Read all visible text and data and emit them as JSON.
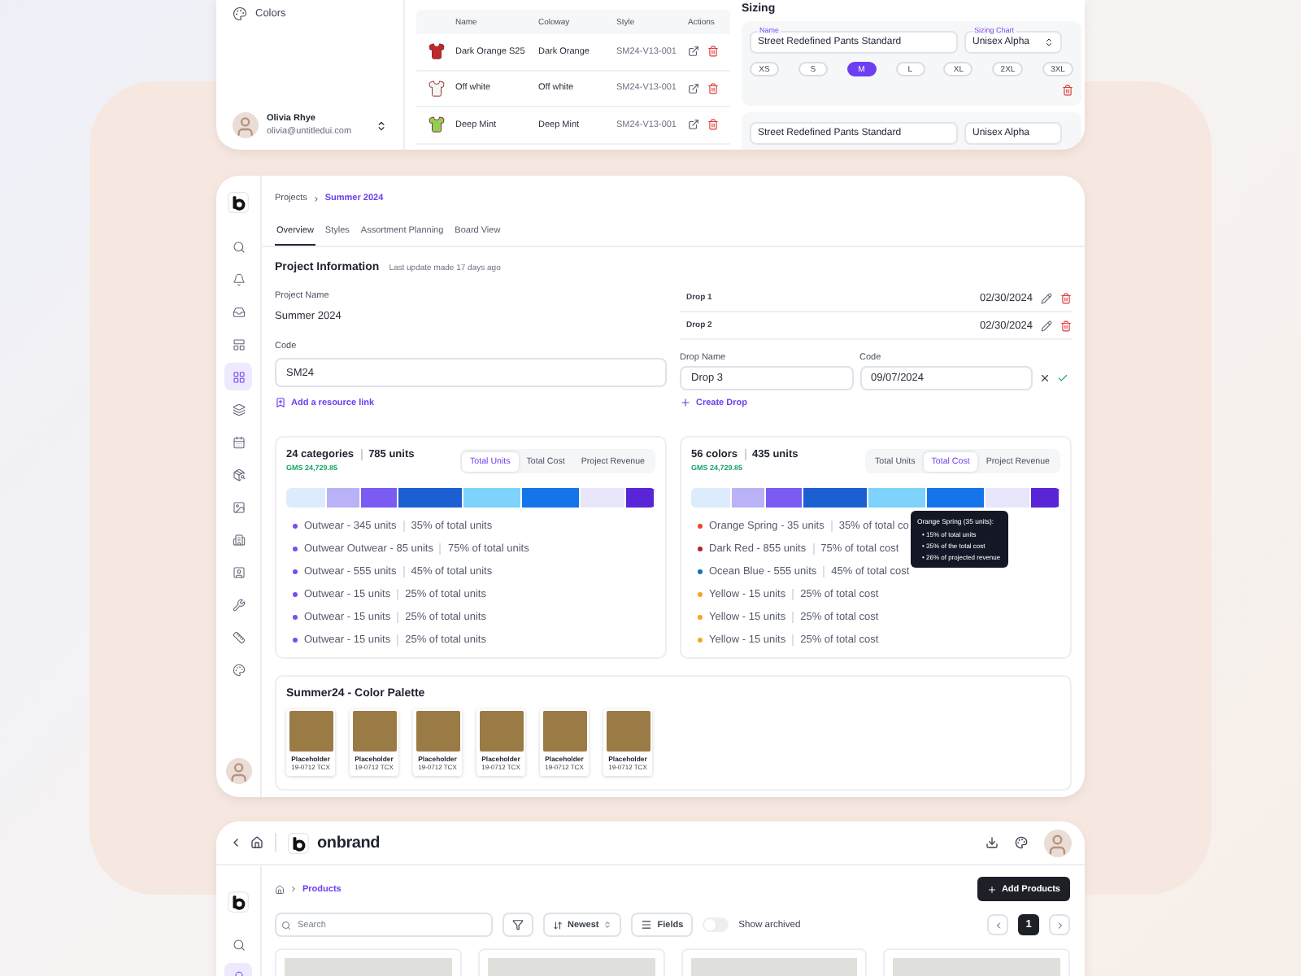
{
  "top_card": {
    "sidebar_item": {
      "label": "Colors"
    },
    "user": {
      "name": "Olivia Rhye",
      "email": "olivia@untitledui.com"
    },
    "table": {
      "columns": [
        "Name",
        "Coloway",
        "Style",
        "Actions"
      ],
      "rows": [
        {
          "name": "Dark Orange S25",
          "colorway": "Dark Orange",
          "style": "SM24-V13-001",
          "color": "#c0282b"
        },
        {
          "name": "Off white",
          "colorway": "Off white",
          "style": "SM24-V13-001",
          "color": "#f4f4f4"
        },
        {
          "name": "Deep Mint",
          "colorway": "Deep Mint",
          "style": "SM24-V13-001",
          "color": "#8fd05a"
        }
      ]
    },
    "sizing": {
      "title": "Sizing",
      "panels": [
        {
          "name_label": "Name",
          "name_value": "Street Redefined Pants Standard",
          "chart_label": "Sizing Chart",
          "chart_value": "Unisex Alpha",
          "sizes": [
            {
              "label": "XS",
              "selected": false
            },
            {
              "label": "S",
              "selected": false
            },
            {
              "label": "M",
              "selected": true
            },
            {
              "label": "L",
              "selected": false
            },
            {
              "label": "XL",
              "selected": false
            },
            {
              "label": "2XL",
              "selected": false
            },
            {
              "label": "3XL",
              "selected": false
            }
          ]
        },
        {
          "name_value": "Street Redefined Pants Standard",
          "chart_value": "Unisex Alpha"
        }
      ]
    }
  },
  "project": {
    "rail": [
      {
        "kind": "search",
        "selected": false
      },
      {
        "kind": "bell",
        "selected": false
      },
      {
        "kind": "inbox",
        "selected": false
      },
      {
        "kind": "panel",
        "selected": false
      },
      {
        "kind": "grid",
        "selected": true
      },
      {
        "kind": "layers",
        "selected": false
      },
      {
        "kind": "calendar",
        "selected": false
      },
      {
        "kind": "package",
        "selected": false
      },
      {
        "kind": "image",
        "selected": false
      },
      {
        "kind": "building",
        "selected": false
      },
      {
        "kind": "contact",
        "selected": false
      },
      {
        "kind": "wrench",
        "selected": false
      },
      {
        "kind": "ruler",
        "selected": false
      },
      {
        "kind": "palette",
        "selected": false
      }
    ],
    "breadcrumb": [
      "Projects",
      "Summer 2024"
    ],
    "tabs": [
      {
        "label": "Overview",
        "selected": true
      },
      {
        "label": "Styles",
        "selected": false
      },
      {
        "label": "Assortment Planning",
        "selected": false
      },
      {
        "label": "Board View",
        "selected": false
      }
    ],
    "heading": "Project Information",
    "updated": "Last update made 17 days ago",
    "project_name": {
      "label": "Project Name",
      "value": "Summer 2024"
    },
    "code": {
      "label": "Code",
      "value": "SM24"
    },
    "resource_link": "Add a resource link",
    "drops": [
      {
        "name": "Drop 1",
        "date": "02/30/2024"
      },
      {
        "name": "Drop 2",
        "date": "02/30/2024"
      }
    ],
    "new_drop": {
      "name_label": "Drop Name",
      "name_value": "Drop 3",
      "code_label": "Code",
      "code_value": "09/07/2024"
    },
    "create_drop": "Create Drop",
    "breakdowns": [
      {
        "count": "24 categories",
        "units": "785 units",
        "gms": "GMS 24,729.85",
        "tabs": [
          {
            "label": "Total Units",
            "selected": true
          },
          {
            "label": "Total Cost",
            "selected": false
          },
          {
            "label": "Project Revenue",
            "selected": false
          }
        ],
        "segments": [
          {
            "color": "#dcecfc"
          },
          {
            "color": "#b9b2f7"
          },
          {
            "color": "#7b5cf2"
          },
          {
            "color": "#1b5fd0"
          },
          {
            "color": "#7dd3fb"
          },
          {
            "color": "#1674ea"
          },
          {
            "color": "#e8e6fb"
          },
          {
            "color": "#5a25d6"
          }
        ],
        "items": [
          {
            "label": "Outwear - 345 units",
            "share": "35% of total units",
            "color": "#7b4cf0"
          },
          {
            "label": "Outwear Outwear - 85 units",
            "share": "75% of total units",
            "color": "#7b4cf0"
          },
          {
            "label": "Outwear - 555 units",
            "share": "45% of total units",
            "color": "#7b4cf0"
          },
          {
            "label": "Outwear - 15 units",
            "share": "25% of total units",
            "color": "#7b4cf0"
          },
          {
            "label": "Outwear - 15 units",
            "share": "25% of total units",
            "color": "#7b4cf0"
          },
          {
            "label": "Outwear - 15 units",
            "share": "25% of total units",
            "color": "#7b4cf0"
          }
        ]
      },
      {
        "count": "56 colors",
        "units": "435 units",
        "gms": "GMS 24,729.85",
        "tabs": [
          {
            "label": "Total Units",
            "selected": false
          },
          {
            "label": "Total Cost",
            "selected": true
          },
          {
            "label": "Project Revenue",
            "selected": false
          }
        ],
        "segments": [
          {
            "color": "#dcecfc"
          },
          {
            "color": "#b9b2f7"
          },
          {
            "color": "#7b5cf2"
          },
          {
            "color": "#1b5fd0"
          },
          {
            "color": "#7dd3fb"
          },
          {
            "color": "#1674ea"
          },
          {
            "color": "#e8e6fb"
          },
          {
            "color": "#5a25d6"
          }
        ],
        "items": [
          {
            "label": "Orange Spring - 35 units",
            "share": "35% of total co",
            "color": "#f0451f"
          },
          {
            "label": "Dark Red - 855 units",
            "share": "75% of total cost",
            "color": "#b3232b"
          },
          {
            "label": "Ocean Blue - 555 units",
            "share": "45% of total cost",
            "color": "#1672b0"
          },
          {
            "label": "Yellow - 15 units",
            "share": "25% of total cost",
            "color": "#f5a623"
          },
          {
            "label": "Yellow - 15 units",
            "share": "25% of total cost",
            "color": "#f5a623"
          },
          {
            "label": "Yellow - 15 units",
            "share": "25% of total cost",
            "color": "#f5a623"
          }
        ],
        "tooltip": {
          "title": "Orange Spring (35 units):",
          "lines": [
            "• 15% of total units",
            "• 35% of the total cost",
            "• 26% of projected revenue"
          ]
        }
      }
    ],
    "palette": {
      "title": "Summer24 - Color Palette",
      "swatches": [
        {
          "color": "#9b7b45",
          "name": "Placeholder",
          "code": "19-0712 TCX"
        },
        {
          "color": "#9b7b45",
          "name": "Placeholder",
          "code": "19-0712 TCX"
        },
        {
          "color": "#9b7b45",
          "name": "Placeholder",
          "code": "19-0712 TCX"
        },
        {
          "color": "#9b7b45",
          "name": "Placeholder",
          "code": "19-0712 TCX"
        },
        {
          "color": "#9b7b45",
          "name": "Placeholder",
          "code": "19-0712 TCX"
        },
        {
          "color": "#9b7b45",
          "name": "Placeholder",
          "code": "19-0712 TCX"
        }
      ]
    }
  },
  "products": {
    "brand": "onbrand",
    "rail": [
      {
        "kind": "search",
        "selected": false
      },
      {
        "kind": "bell",
        "selected": true
      }
    ],
    "breadcrumb": "Products",
    "add_button": "Add Products",
    "search_placeholder": "Search",
    "sort": "Newest",
    "fields": "Fields",
    "archived": {
      "label": "Show archived",
      "on": false
    },
    "page": "1",
    "cards": [
      {
        "kind": "photo"
      },
      {
        "kind": "photo"
      },
      {
        "kind": "photo"
      },
      {
        "kind": "photo"
      }
    ]
  }
}
